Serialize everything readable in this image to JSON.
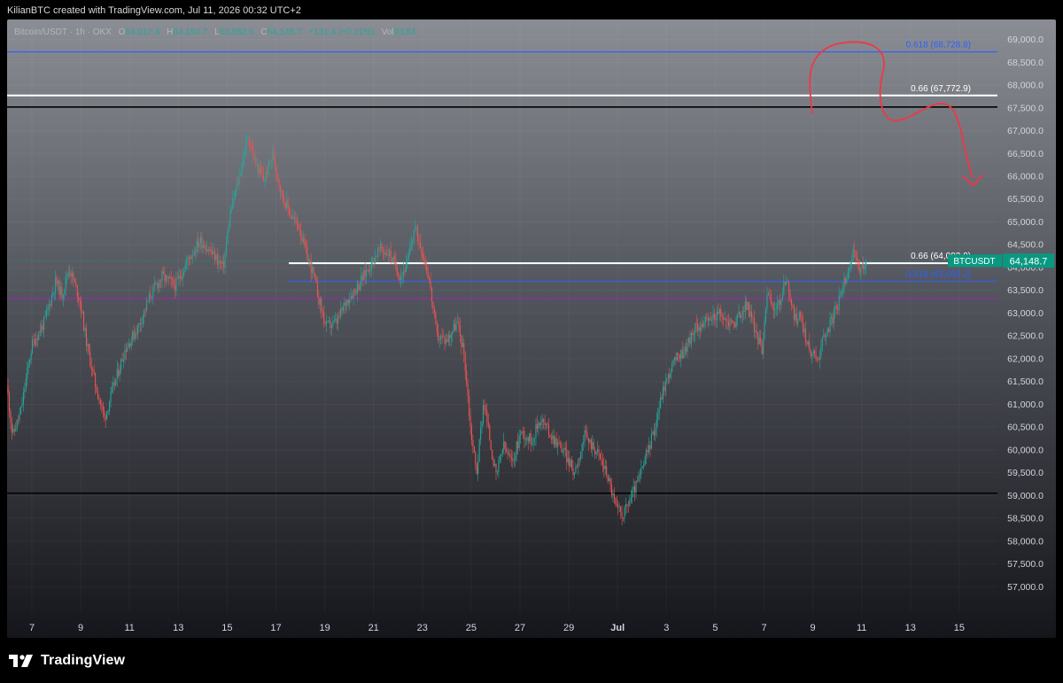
{
  "header": {
    "text": "KilianBTC created with TradingView.com, Jul 11, 2026 00:32 UTC+2"
  },
  "legend": {
    "symbol": "Bitcoin/USDT · 1h · OKX",
    "open_label": "O",
    "open": "64,017.4",
    "high_label": "H",
    "high": "64,154.7",
    "low_label": "L",
    "low": "63,982.6",
    "close_label": "C",
    "close": "64,148.7",
    "change": "+131.4 (+0.21%)",
    "vol_label": "Vol",
    "vol": "93.84"
  },
  "footer": {
    "brand": "TradingView"
  },
  "colors": {
    "bull": "#26a69a",
    "bear": "#ef5350",
    "white_line": "#ffffff",
    "black_line": "#000000",
    "blue_line": "#2962ff",
    "magenta_line": "#9c27b0",
    "drawing": "#f23645",
    "price_badge": "#089981"
  },
  "chart_data": {
    "type": "candlestick",
    "symbol": "Bitcoin/USDT",
    "interval": "1h",
    "exchange": "OKX",
    "ylim": [
      56500,
      69400
    ],
    "y_ticks": [
      "69,000.0",
      "68,500.0",
      "68,000.0",
      "67,500.0",
      "67,000.0",
      "66,500.0",
      "66,000.0",
      "65,500.0",
      "65,000.0",
      "64,500.0",
      "64,000.0",
      "63,500.0",
      "63,000.0",
      "62,500.0",
      "62,000.0",
      "61,500.0",
      "61,000.0",
      "60,500.0",
      "60,000.0",
      "59,500.0",
      "59,000.0",
      "58,500.0",
      "58,000.0",
      "57,500.0",
      "57,000.0"
    ],
    "x_ticks": [
      "7",
      "9",
      "11",
      "13",
      "15",
      "17",
      "19",
      "21",
      "23",
      "25",
      "27",
      "29",
      "Jul",
      "3",
      "5",
      "7",
      "9",
      "11",
      "13",
      "15"
    ],
    "last_price": {
      "symbol": "BTCUSDT",
      "value": 64148.7,
      "label": "64,148.7"
    },
    "price_path": [
      [
        0,
        61400
      ],
      [
        6,
        60300
      ],
      [
        15,
        60800
      ],
      [
        28,
        62300
      ],
      [
        42,
        62800
      ],
      [
        55,
        63700
      ],
      [
        62,
        63400
      ],
      [
        70,
        64000
      ],
      [
        82,
        63300
      ],
      [
        90,
        62300
      ],
      [
        100,
        61400
      ],
      [
        110,
        60700
      ],
      [
        122,
        61500
      ],
      [
        133,
        62200
      ],
      [
        148,
        62700
      ],
      [
        162,
        63400
      ],
      [
        175,
        63800
      ],
      [
        190,
        63600
      ],
      [
        205,
        64200
      ],
      [
        218,
        64600
      ],
      [
        232,
        64300
      ],
      [
        244,
        64000
      ],
      [
        252,
        65200
      ],
      [
        262,
        66000
      ],
      [
        272,
        66900
      ],
      [
        280,
        66300
      ],
      [
        290,
        65900
      ],
      [
        300,
        66500
      ],
      [
        310,
        65600
      ],
      [
        322,
        65100
      ],
      [
        330,
        64900
      ],
      [
        336,
        64400
      ],
      [
        345,
        63900
      ],
      [
        352,
        63300
      ],
      [
        360,
        62700
      ],
      [
        372,
        62800
      ],
      [
        384,
        63300
      ],
      [
        396,
        63600
      ],
      [
        408,
        64000
      ],
      [
        420,
        64400
      ],
      [
        432,
        64300
      ],
      [
        444,
        63800
      ],
      [
        452,
        64100
      ],
      [
        460,
        64900
      ],
      [
        468,
        64400
      ],
      [
        476,
        63800
      ],
      [
        485,
        62500
      ],
      [
        496,
        62400
      ],
      [
        508,
        62800
      ],
      [
        516,
        62100
      ],
      [
        523,
        60500
      ],
      [
        530,
        59500
      ],
      [
        538,
        61100
      ],
      [
        546,
        60100
      ],
      [
        552,
        59400
      ],
      [
        560,
        60100
      ],
      [
        570,
        59700
      ],
      [
        580,
        60400
      ],
      [
        592,
        60200
      ],
      [
        602,
        60700
      ],
      [
        615,
        60300
      ],
      [
        628,
        60000
      ],
      [
        640,
        59500
      ],
      [
        652,
        60300
      ],
      [
        665,
        60000
      ],
      [
        677,
        59500
      ],
      [
        688,
        58700
      ],
      [
        696,
        58600
      ],
      [
        705,
        59000
      ],
      [
        714,
        59400
      ],
      [
        722,
        59900
      ],
      [
        730,
        60400
      ],
      [
        740,
        61300
      ],
      [
        752,
        61900
      ],
      [
        765,
        62200
      ],
      [
        778,
        62700
      ],
      [
        790,
        62800
      ],
      [
        802,
        63000
      ],
      [
        813,
        62800
      ],
      [
        822,
        62800
      ],
      [
        835,
        63200
      ],
      [
        845,
        62600
      ],
      [
        852,
        62200
      ],
      [
        858,
        63500
      ],
      [
        864,
        63100
      ],
      [
        872,
        63200
      ],
      [
        880,
        63800
      ],
      [
        888,
        62900
      ],
      [
        896,
        62900
      ],
      [
        905,
        62200
      ],
      [
        915,
        62000
      ],
      [
        922,
        62500
      ],
      [
        930,
        62800
      ],
      [
        940,
        63300
      ],
      [
        948,
        63900
      ],
      [
        955,
        64300
      ],
      [
        962,
        63900
      ],
      [
        970,
        64100
      ]
    ],
    "levels": [
      {
        "price": 68728.8,
        "color": "blue",
        "label": "0.618 (68,728.8)"
      },
      {
        "price": 67772.9,
        "color": "white",
        "label": "0.66 (67,772.9)"
      },
      {
        "price": 67520,
        "color": "black",
        "label": ""
      },
      {
        "price": 64093.0,
        "color": "white",
        "label": "0.66 (64,093.0)"
      },
      {
        "price": 63693.2,
        "color": "blue",
        "label": "0.618 (63,693.2)"
      },
      {
        "price": 63320,
        "color": "magenta",
        "label": ""
      },
      {
        "price": 59050,
        "color": "black",
        "label": ""
      }
    ]
  }
}
